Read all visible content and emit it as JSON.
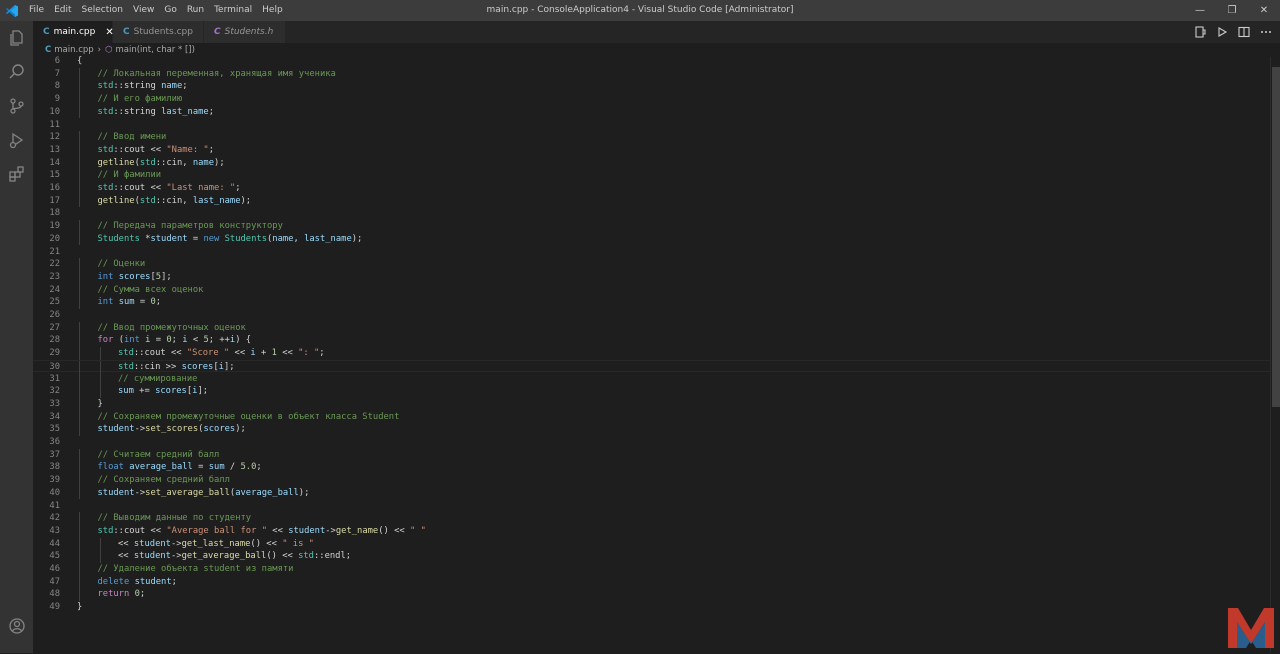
{
  "window": {
    "title": "main.cpp - ConsoleApplication4 - Visual Studio Code [Administrator]",
    "menu": [
      "File",
      "Edit",
      "Selection",
      "View",
      "Go",
      "Run",
      "Terminal",
      "Help"
    ]
  },
  "tabs": [
    {
      "label": "main.cpp",
      "active": true
    },
    {
      "label": "Students.cpp",
      "active": false
    },
    {
      "label": "Students.h",
      "active": false
    }
  ],
  "breadcrumb": {
    "file": "main.cpp",
    "symbol": "main(int, char * [])"
  },
  "editor": {
    "current_line": 30,
    "lines": [
      {
        "n": "6",
        "indent": 0,
        "tokens": [
          {
            "t": "{",
            "c": "#d4d4d4"
          }
        ]
      },
      {
        "n": "7",
        "indent": 1,
        "tokens": [
          {
            "t": "// Локальная переменная, хранящая имя ученика",
            "c": "#6a9955"
          }
        ]
      },
      {
        "n": "8",
        "indent": 1,
        "tokens": [
          {
            "t": "std",
            "c": "#4ec9b0"
          },
          {
            "t": "::string ",
            "c": "#d4d4d4"
          },
          {
            "t": "name",
            "c": "#9cdcfe"
          },
          {
            "t": ";",
            "c": "#d4d4d4"
          }
        ]
      },
      {
        "n": "9",
        "indent": 1,
        "tokens": [
          {
            "t": "// И его фамилию",
            "c": "#6a9955"
          }
        ]
      },
      {
        "n": "10",
        "indent": 1,
        "tokens": [
          {
            "t": "std",
            "c": "#4ec9b0"
          },
          {
            "t": "::string ",
            "c": "#d4d4d4"
          },
          {
            "t": "last_name",
            "c": "#9cdcfe"
          },
          {
            "t": ";",
            "c": "#d4d4d4"
          }
        ]
      },
      {
        "n": "11",
        "indent": 0,
        "tokens": []
      },
      {
        "n": "12",
        "indent": 1,
        "tokens": [
          {
            "t": "// Ввод имени",
            "c": "#6a9955"
          }
        ]
      },
      {
        "n": "13",
        "indent": 1,
        "tokens": [
          {
            "t": "std",
            "c": "#4ec9b0"
          },
          {
            "t": "::cout << ",
            "c": "#d4d4d4"
          },
          {
            "t": "\"Name: \"",
            "c": "#ce9178"
          },
          {
            "t": ";",
            "c": "#d4d4d4"
          }
        ]
      },
      {
        "n": "14",
        "indent": 1,
        "tokens": [
          {
            "t": "getline",
            "c": "#dcdcaa"
          },
          {
            "t": "(",
            "c": "#d4d4d4"
          },
          {
            "t": "std",
            "c": "#4ec9b0"
          },
          {
            "t": "::cin, ",
            "c": "#d4d4d4"
          },
          {
            "t": "name",
            "c": "#9cdcfe"
          },
          {
            "t": ");",
            "c": "#d4d4d4"
          }
        ]
      },
      {
        "n": "15",
        "indent": 1,
        "tokens": [
          {
            "t": "// И фамилии",
            "c": "#6a9955"
          }
        ]
      },
      {
        "n": "16",
        "indent": 1,
        "tokens": [
          {
            "t": "std",
            "c": "#4ec9b0"
          },
          {
            "t": "::cout << ",
            "c": "#d4d4d4"
          },
          {
            "t": "\"Last name: \"",
            "c": "#ce9178"
          },
          {
            "t": ";",
            "c": "#d4d4d4"
          }
        ]
      },
      {
        "n": "17",
        "indent": 1,
        "tokens": [
          {
            "t": "getline",
            "c": "#dcdcaa"
          },
          {
            "t": "(",
            "c": "#d4d4d4"
          },
          {
            "t": "std",
            "c": "#4ec9b0"
          },
          {
            "t": "::cin, ",
            "c": "#d4d4d4"
          },
          {
            "t": "last_name",
            "c": "#9cdcfe"
          },
          {
            "t": ");",
            "c": "#d4d4d4"
          }
        ]
      },
      {
        "n": "18",
        "indent": 0,
        "tokens": []
      },
      {
        "n": "19",
        "indent": 1,
        "tokens": [
          {
            "t": "// Передача параметров конструктору",
            "c": "#6a9955"
          }
        ]
      },
      {
        "n": "20",
        "indent": 1,
        "tokens": [
          {
            "t": "Students ",
            "c": "#4ec9b0"
          },
          {
            "t": "*",
            "c": "#d4d4d4"
          },
          {
            "t": "student",
            "c": "#9cdcfe"
          },
          {
            "t": " = ",
            "c": "#d4d4d4"
          },
          {
            "t": "new ",
            "c": "#569cd6"
          },
          {
            "t": "Students",
            "c": "#4ec9b0"
          },
          {
            "t": "(",
            "c": "#d4d4d4"
          },
          {
            "t": "name",
            "c": "#9cdcfe"
          },
          {
            "t": ", ",
            "c": "#d4d4d4"
          },
          {
            "t": "last_name",
            "c": "#9cdcfe"
          },
          {
            "t": ");",
            "c": "#d4d4d4"
          }
        ]
      },
      {
        "n": "21",
        "indent": 0,
        "tokens": []
      },
      {
        "n": "22",
        "indent": 1,
        "tokens": [
          {
            "t": "// Оценки",
            "c": "#6a9955"
          }
        ]
      },
      {
        "n": "23",
        "indent": 1,
        "tokens": [
          {
            "t": "int ",
            "c": "#569cd6"
          },
          {
            "t": "scores",
            "c": "#9cdcfe"
          },
          {
            "t": "[",
            "c": "#d4d4d4"
          },
          {
            "t": "5",
            "c": "#b5cea8"
          },
          {
            "t": "];",
            "c": "#d4d4d4"
          }
        ]
      },
      {
        "n": "24",
        "indent": 1,
        "tokens": [
          {
            "t": "// Сумма всех оценок",
            "c": "#6a9955"
          }
        ]
      },
      {
        "n": "25",
        "indent": 1,
        "tokens": [
          {
            "t": "int ",
            "c": "#569cd6"
          },
          {
            "t": "sum",
            "c": "#9cdcfe"
          },
          {
            "t": " = ",
            "c": "#d4d4d4"
          },
          {
            "t": "0",
            "c": "#b5cea8"
          },
          {
            "t": ";",
            "c": "#d4d4d4"
          }
        ]
      },
      {
        "n": "26",
        "indent": 0,
        "tokens": []
      },
      {
        "n": "27",
        "indent": 1,
        "tokens": [
          {
            "t": "// Ввод промежуточных оценок",
            "c": "#6a9955"
          }
        ]
      },
      {
        "n": "28",
        "indent": 1,
        "tokens": [
          {
            "t": "for ",
            "c": "#c586c0"
          },
          {
            "t": "(",
            "c": "#d4d4d4"
          },
          {
            "t": "int ",
            "c": "#569cd6"
          },
          {
            "t": "i",
            "c": "#9cdcfe"
          },
          {
            "t": " = ",
            "c": "#d4d4d4"
          },
          {
            "t": "0",
            "c": "#b5cea8"
          },
          {
            "t": "; ",
            "c": "#d4d4d4"
          },
          {
            "t": "i",
            "c": "#9cdcfe"
          },
          {
            "t": " < ",
            "c": "#d4d4d4"
          },
          {
            "t": "5",
            "c": "#b5cea8"
          },
          {
            "t": "; ++",
            "c": "#d4d4d4"
          },
          {
            "t": "i",
            "c": "#9cdcfe"
          },
          {
            "t": ") {",
            "c": "#d4d4d4"
          }
        ]
      },
      {
        "n": "29",
        "indent": 2,
        "tokens": [
          {
            "t": "std",
            "c": "#4ec9b0"
          },
          {
            "t": "::cout << ",
            "c": "#d4d4d4"
          },
          {
            "t": "\"Score \"",
            "c": "#ce9178"
          },
          {
            "t": " << ",
            "c": "#d4d4d4"
          },
          {
            "t": "i",
            "c": "#9cdcfe"
          },
          {
            "t": " + ",
            "c": "#d4d4d4"
          },
          {
            "t": "1",
            "c": "#b5cea8"
          },
          {
            "t": " << ",
            "c": "#d4d4d4"
          },
          {
            "t": "\": \"",
            "c": "#ce9178"
          },
          {
            "t": ";",
            "c": "#d4d4d4"
          }
        ]
      },
      {
        "n": "30",
        "indent": 2,
        "tokens": [
          {
            "t": "std",
            "c": "#4ec9b0"
          },
          {
            "t": "::cin >> ",
            "c": "#d4d4d4"
          },
          {
            "t": "scores",
            "c": "#9cdcfe"
          },
          {
            "t": "[",
            "c": "#d4d4d4"
          },
          {
            "t": "i",
            "c": "#9cdcfe"
          },
          {
            "t": "];",
            "c": "#d4d4d4"
          }
        ]
      },
      {
        "n": "31",
        "indent": 2,
        "tokens": [
          {
            "t": "// суммирование",
            "c": "#6a9955"
          }
        ]
      },
      {
        "n": "32",
        "indent": 2,
        "tokens": [
          {
            "t": "sum",
            "c": "#9cdcfe"
          },
          {
            "t": " += ",
            "c": "#d4d4d4"
          },
          {
            "t": "scores",
            "c": "#9cdcfe"
          },
          {
            "t": "[",
            "c": "#d4d4d4"
          },
          {
            "t": "i",
            "c": "#9cdcfe"
          },
          {
            "t": "];",
            "c": "#d4d4d4"
          }
        ]
      },
      {
        "n": "33",
        "indent": 1,
        "tokens": [
          {
            "t": "}",
            "c": "#d4d4d4"
          }
        ]
      },
      {
        "n": "34",
        "indent": 1,
        "tokens": [
          {
            "t": "// Сохраняем промежуточные оценки в объект класса Student",
            "c": "#6a9955"
          }
        ]
      },
      {
        "n": "35",
        "indent": 1,
        "tokens": [
          {
            "t": "student",
            "c": "#9cdcfe"
          },
          {
            "t": "->",
            "c": "#d4d4d4"
          },
          {
            "t": "set_scores",
            "c": "#dcdcaa"
          },
          {
            "t": "(",
            "c": "#d4d4d4"
          },
          {
            "t": "scores",
            "c": "#9cdcfe"
          },
          {
            "t": ");",
            "c": "#d4d4d4"
          }
        ]
      },
      {
        "n": "36",
        "indent": 0,
        "tokens": []
      },
      {
        "n": "37",
        "indent": 1,
        "tokens": [
          {
            "t": "// Считаем средний балл",
            "c": "#6a9955"
          }
        ]
      },
      {
        "n": "38",
        "indent": 1,
        "tokens": [
          {
            "t": "float ",
            "c": "#569cd6"
          },
          {
            "t": "average_ball",
            "c": "#9cdcfe"
          },
          {
            "t": " = ",
            "c": "#d4d4d4"
          },
          {
            "t": "sum",
            "c": "#9cdcfe"
          },
          {
            "t": " / ",
            "c": "#d4d4d4"
          },
          {
            "t": "5.0",
            "c": "#b5cea8"
          },
          {
            "t": ";",
            "c": "#d4d4d4"
          }
        ]
      },
      {
        "n": "39",
        "indent": 1,
        "tokens": [
          {
            "t": "// Сохраняем средний балл",
            "c": "#6a9955"
          }
        ]
      },
      {
        "n": "40",
        "indent": 1,
        "tokens": [
          {
            "t": "student",
            "c": "#9cdcfe"
          },
          {
            "t": "->",
            "c": "#d4d4d4"
          },
          {
            "t": "set_average_ball",
            "c": "#dcdcaa"
          },
          {
            "t": "(",
            "c": "#d4d4d4"
          },
          {
            "t": "average_ball",
            "c": "#9cdcfe"
          },
          {
            "t": ");",
            "c": "#d4d4d4"
          }
        ]
      },
      {
        "n": "41",
        "indent": 0,
        "tokens": []
      },
      {
        "n": "42",
        "indent": 1,
        "tokens": [
          {
            "t": "// Выводим данные по студенту",
            "c": "#6a9955"
          }
        ]
      },
      {
        "n": "43",
        "indent": 1,
        "tokens": [
          {
            "t": "std",
            "c": "#4ec9b0"
          },
          {
            "t": "::cout << ",
            "c": "#d4d4d4"
          },
          {
            "t": "\"Average ball for \"",
            "c": "#ce9178"
          },
          {
            "t": " << ",
            "c": "#d4d4d4"
          },
          {
            "t": "student",
            "c": "#9cdcfe"
          },
          {
            "t": "->",
            "c": "#d4d4d4"
          },
          {
            "t": "get_name",
            "c": "#dcdcaa"
          },
          {
            "t": "() << ",
            "c": "#d4d4d4"
          },
          {
            "t": "\" \"",
            "c": "#ce9178"
          }
        ]
      },
      {
        "n": "44",
        "indent": 2,
        "tokens": [
          {
            "t": "<< ",
            "c": "#d4d4d4"
          },
          {
            "t": "student",
            "c": "#9cdcfe"
          },
          {
            "t": "->",
            "c": "#d4d4d4"
          },
          {
            "t": "get_last_name",
            "c": "#dcdcaa"
          },
          {
            "t": "() << ",
            "c": "#d4d4d4"
          },
          {
            "t": "\" is \"",
            "c": "#ce9178"
          }
        ]
      },
      {
        "n": "45",
        "indent": 2,
        "tokens": [
          {
            "t": "<< ",
            "c": "#d4d4d4"
          },
          {
            "t": "student",
            "c": "#9cdcfe"
          },
          {
            "t": "->",
            "c": "#d4d4d4"
          },
          {
            "t": "get_average_ball",
            "c": "#dcdcaa"
          },
          {
            "t": "() << ",
            "c": "#d4d4d4"
          },
          {
            "t": "std",
            "c": "#4ec9b0"
          },
          {
            "t": "::endl;",
            "c": "#d4d4d4"
          }
        ]
      },
      {
        "n": "46",
        "indent": 1,
        "tokens": [
          {
            "t": "// Удаление объекта student из памяти",
            "c": "#6a9955"
          }
        ]
      },
      {
        "n": "47",
        "indent": 1,
        "tokens": [
          {
            "t": "delete ",
            "c": "#569cd6"
          },
          {
            "t": "student",
            "c": "#9cdcfe"
          },
          {
            "t": ";",
            "c": "#d4d4d4"
          }
        ]
      },
      {
        "n": "48",
        "indent": 1,
        "tokens": [
          {
            "t": "return ",
            "c": "#c586c0"
          },
          {
            "t": "0",
            "c": "#b5cea8"
          },
          {
            "t": ";",
            "c": "#d4d4d4"
          }
        ]
      },
      {
        "n": "49",
        "indent": 0,
        "tokens": [
          {
            "t": "}",
            "c": "#d4d4d4"
          }
        ]
      }
    ]
  },
  "icons": {
    "activity_bar": [
      "explorer-icon",
      "search-icon",
      "source-control-icon",
      "run-debug-icon",
      "extensions-icon",
      "accounts-icon"
    ],
    "tab_actions": [
      "split-preview-icon",
      "run-icon",
      "split-editor-icon",
      "more-icon"
    ]
  },
  "colors": {
    "accent": "#0e639c",
    "cpp_icon": "#519aba",
    "logo_red": "#c0392b",
    "logo_blue": "#2c6aa0"
  }
}
